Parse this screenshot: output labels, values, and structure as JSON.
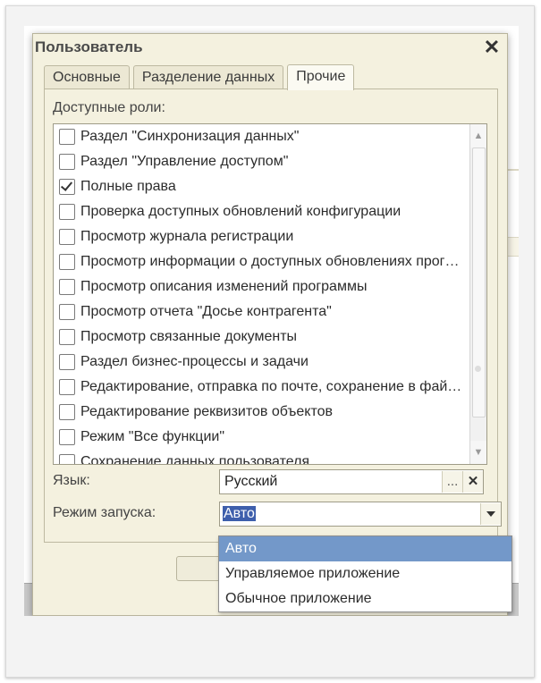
{
  "window": {
    "title": "Пользователь",
    "close_icon": "close-icon"
  },
  "tabs": [
    {
      "label": "Основные"
    },
    {
      "label": "Разделение данных"
    },
    {
      "label": "Прочие"
    }
  ],
  "roles": {
    "label": "Доступные роли:",
    "items": [
      {
        "label": "Раздел \"Синхронизация данных\"",
        "checked": false
      },
      {
        "label": "Раздел \"Управление доступом\"",
        "checked": false
      },
      {
        "label": "Полные права",
        "checked": true
      },
      {
        "label": "Проверка доступных обновлений конфигурации",
        "checked": false
      },
      {
        "label": "Просмотр журнала регистрации",
        "checked": false
      },
      {
        "label": "Просмотр информации о доступных обновлениях прогр…",
        "checked": false
      },
      {
        "label": "Просмотр описания изменений программы",
        "checked": false
      },
      {
        "label": "Просмотр отчета \"Досье контрагента\"",
        "checked": false
      },
      {
        "label": "Просмотр связанные документы",
        "checked": false
      },
      {
        "label": "Раздел бизнес-процессы и задачи",
        "checked": false
      },
      {
        "label": "Редактирование, отправка по почте, сохранение в фай…",
        "checked": false
      },
      {
        "label": "Редактирование реквизитов объектов",
        "checked": false
      },
      {
        "label": "Режим \"Все функции\"",
        "checked": false
      },
      {
        "label": "Сохранение данных пользователя",
        "checked": false
      }
    ]
  },
  "language": {
    "label": "Язык:",
    "value": "Русский",
    "select_button": "...",
    "clear_button": "✕"
  },
  "launch_mode": {
    "label": "Режим запуска:",
    "value": "Авто",
    "options": [
      {
        "label": "Авто",
        "selected": true
      },
      {
        "label": "Управляемое приложение",
        "selected": false
      },
      {
        "label": "Обычное приложение",
        "selected": false
      }
    ]
  },
  "colors": {
    "dialog_bg": "#f4f1df",
    "selection": "#7398c9",
    "text_highlight": "#3e5fac"
  }
}
